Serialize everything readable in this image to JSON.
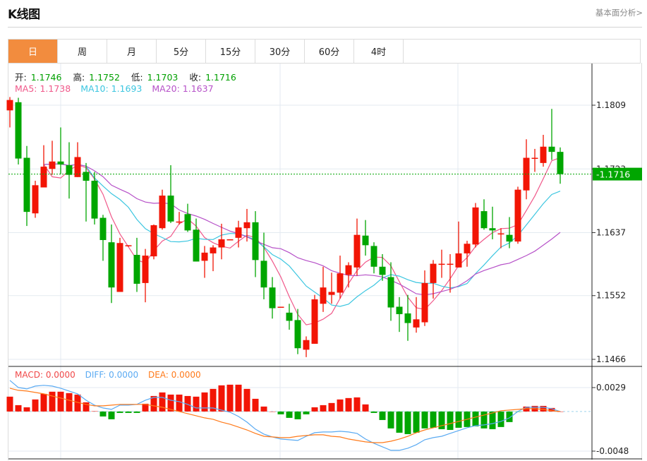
{
  "header": {
    "title": "K线图",
    "fundamental_link": "基本面分析>"
  },
  "tabs": [
    {
      "label": "日",
      "active": true
    },
    {
      "label": "周"
    },
    {
      "label": "月"
    },
    {
      "label": "5分"
    },
    {
      "label": "15分"
    },
    {
      "label": "30分"
    },
    {
      "label": "60分"
    },
    {
      "label": "4时"
    }
  ],
  "ohlc_legend": {
    "open_label": "开:",
    "open": "1.1746",
    "high_label": "高:",
    "high": "1.1752",
    "low_label": "低:",
    "low": "1.1703",
    "close_label": "收:",
    "close": "1.1716"
  },
  "ma_legend": {
    "ma5": "MA5: 1.1738",
    "ma10": "MA10: 1.1693",
    "ma20": "MA20: 1.1637"
  },
  "macd_legend": {
    "macd": "MACD: 0.0000",
    "diff": "DIFF: 0.0000",
    "dea": "DEA: 0.0000"
  },
  "colors": {
    "up": "#f21505",
    "down": "#00a600",
    "ma5": "#f0588a",
    "ma10": "#3cc6e0",
    "ma20": "#b651c8",
    "diff": "#5aaaf2",
    "dea": "#ff7a1a",
    "accent": "#f28c3e",
    "current_price": "#00a600"
  },
  "chart_data": [
    {
      "type": "candlestick",
      "price_ticks": [
        "1.1809",
        "1.1723",
        "1.1637",
        "1.1552",
        "1.1466"
      ],
      "ylim": [
        1.1466,
        1.1809
      ],
      "current_price": "1.1716",
      "grid": true,
      "ma_periods": [
        5,
        10,
        20
      ],
      "ohlc": [
        [
          1.1802,
          1.182,
          1.1779,
          1.1816
        ],
        [
          1.1813,
          1.1819,
          1.1729,
          1.1737
        ],
        [
          1.1738,
          1.1754,
          1.1646,
          1.1665
        ],
        [
          1.1663,
          1.1707,
          1.1657,
          1.1701
        ],
        [
          1.1698,
          1.1755,
          1.1698,
          1.1726
        ],
        [
          1.1723,
          1.1761,
          1.1715,
          1.1733
        ],
        [
          1.1733,
          1.1779,
          1.1716,
          1.1729
        ],
        [
          1.1728,
          1.1759,
          1.1683,
          1.1715
        ],
        [
          1.1712,
          1.1759,
          1.1712,
          1.1739
        ],
        [
          1.1719,
          1.1731,
          1.1652,
          1.1707
        ],
        [
          1.1707,
          1.1719,
          1.1648,
          1.1656
        ],
        [
          1.1657,
          1.1661,
          1.1599,
          1.1627
        ],
        [
          1.1624,
          1.1648,
          1.1542,
          1.1563
        ],
        [
          1.1557,
          1.163,
          1.1557,
          1.1623
        ],
        [
          1.1619,
          1.162,
          1.1618,
          1.162
        ],
        [
          1.1607,
          1.163,
          1.1557,
          1.1568
        ],
        [
          1.1569,
          1.1615,
          1.1543,
          1.1606
        ],
        [
          1.1605,
          1.1648,
          1.1601,
          1.1647
        ],
        [
          1.1643,
          1.1695,
          1.1641,
          1.1687
        ],
        [
          1.1687,
          1.1728,
          1.165,
          1.1652
        ],
        [
          1.1651,
          1.1665,
          1.1648,
          1.1652
        ],
        [
          1.1662,
          1.1676,
          1.1638,
          1.164
        ],
        [
          1.1641,
          1.1656,
          1.1598,
          1.1598
        ],
        [
          1.1599,
          1.1619,
          1.1576,
          1.161
        ],
        [
          1.1609,
          1.162,
          1.1585,
          1.1617
        ],
        [
          1.1617,
          1.1649,
          1.1601,
          1.1628
        ],
        [
          1.1627,
          1.1628,
          1.1627,
          1.1628
        ],
        [
          1.163,
          1.1653,
          1.1617,
          1.1644
        ],
        [
          1.1643,
          1.1669,
          1.1625,
          1.1651
        ],
        [
          1.1651,
          1.1666,
          1.1577,
          1.16
        ],
        [
          1.1599,
          1.1637,
          1.1547,
          1.1563
        ],
        [
          1.1563,
          1.1577,
          1.1521,
          1.1535
        ],
        [
          1.1536,
          1.1537,
          1.1536,
          1.1537
        ],
        [
          1.1529,
          1.1541,
          1.1506,
          1.1518
        ],
        [
          1.1519,
          1.1534,
          1.1473,
          1.1481
        ],
        [
          1.1479,
          1.1497,
          1.1469,
          1.1492
        ],
        [
          1.1487,
          1.1553,
          1.1487,
          1.1547
        ],
        [
          1.1541,
          1.1591,
          1.153,
          1.1563
        ],
        [
          1.1553,
          1.1583,
          1.1541,
          1.1557
        ],
        [
          1.1556,
          1.1606,
          1.1548,
          1.1582
        ],
        [
          1.158,
          1.1597,
          1.1563,
          1.1593
        ],
        [
          1.159,
          1.1656,
          1.1579,
          1.1634
        ],
        [
          1.1633,
          1.1654,
          1.1606,
          1.162
        ],
        [
          1.1619,
          1.1624,
          1.1582,
          1.1591
        ],
        [
          1.1591,
          1.1608,
          1.1572,
          1.158
        ],
        [
          1.1577,
          1.1597,
          1.1518,
          1.1536
        ],
        [
          1.1537,
          1.155,
          1.1503,
          1.1527
        ],
        [
          1.1528,
          1.1553,
          1.1491,
          1.1515
        ],
        [
          1.1509,
          1.155,
          1.1502,
          1.152
        ],
        [
          1.1516,
          1.1586,
          1.1511,
          1.1569
        ],
        [
          1.1569,
          1.16,
          1.1548,
          1.1595
        ],
        [
          1.1594,
          1.1614,
          1.1576,
          1.1595
        ],
        [
          1.1594,
          1.1608,
          1.1556,
          1.1595
        ],
        [
          1.159,
          1.1652,
          1.159,
          1.1609
        ],
        [
          1.1609,
          1.1626,
          1.1591,
          1.1622
        ],
        [
          1.1621,
          1.1677,
          1.1617,
          1.1671
        ],
        [
          1.1666,
          1.1682,
          1.1641,
          1.1643
        ],
        [
          1.1643,
          1.1672,
          1.1628,
          1.164
        ],
        [
          1.1635,
          1.1643,
          1.1616,
          1.1636
        ],
        [
          1.1634,
          1.1658,
          1.1616,
          1.1625
        ],
        [
          1.1625,
          1.1699,
          1.1622,
          1.1695
        ],
        [
          1.1694,
          1.1763,
          1.1682,
          1.1738
        ],
        [
          1.1737,
          1.175,
          1.1719,
          1.1738
        ],
        [
          1.1731,
          1.1769,
          1.1726,
          1.1753
        ],
        [
          1.1753,
          1.1804,
          1.1735,
          1.1746
        ],
        [
          1.1746,
          1.1752,
          1.1703,
          1.1716
        ]
      ]
    },
    {
      "type": "macd",
      "ticks": [
        "0.0029",
        "-0.0048"
      ],
      "ylim": [
        -0.0048,
        0.0029
      ],
      "histogram": [
        0.0018,
        0.00077,
        0.00051,
        0.00146,
        0.00214,
        0.0024,
        0.0024,
        0.00223,
        0.00205,
        0.00111,
        4e-05,
        -0.0006,
        -0.00094,
        -0.00017,
        -0.00017,
        -0.00017,
        0.00094,
        0.00188,
        0.00231,
        0.00205,
        0.00205,
        0.00188,
        0.0018,
        0.00231,
        0.00274,
        0.00317,
        0.00325,
        0.00325,
        0.00274,
        0.00154,
        0.0006,
        0,
        -0.00034,
        -0.00077,
        -0.00094,
        -0.00034,
        0.00051,
        0.00077,
        0.00103,
        0.00146,
        0.00163,
        0.00171,
        0.00086,
        -0.00017,
        -0.00103,
        -0.00205,
        -0.00257,
        -0.00274,
        -0.00257,
        -0.00205,
        -0.00197,
        -0.00214,
        -0.00223,
        -0.00197,
        -0.00188,
        -0.0018,
        -0.00205,
        -0.00214,
        -0.00188,
        -0.00128,
        -4e-05,
        0.0006,
        0.00068,
        0.00068,
        0.00043,
        0
      ],
      "diff": [
        0.00377,
        0.00291,
        0.00274,
        0.00308,
        0.00317,
        0.00308,
        0.00282,
        0.00248,
        0.00214,
        0.00137,
        0.00077,
        0.00043,
        0.00026,
        0.00077,
        0.00077,
        0.00086,
        0.00137,
        0.00171,
        0.00171,
        0.00137,
        0.0012,
        0.00086,
        0.00043,
        0.00043,
        0.00043,
        0.00017,
        -9e-05,
        -0.0006,
        -0.00128,
        -0.00214,
        -0.00274,
        -0.00308,
        -0.00334,
        -0.00342,
        -0.00351,
        -0.003,
        -0.00257,
        -0.00248,
        -0.00248,
        -0.0024,
        -0.00248,
        -0.00265,
        -0.00334,
        -0.00385,
        -0.00428,
        -0.00471,
        -0.00471,
        -0.00445,
        -0.00402,
        -0.00342,
        -0.00317,
        -0.003,
        -0.00265,
        -0.00231,
        -0.00197,
        -0.00171,
        -0.00163,
        -0.00146,
        -0.0012,
        -0.00077,
        0,
        0.00051,
        0.00051,
        0.00051,
        0.00034,
        0
      ],
      "dea": [
        0.00282,
        0.00257,
        0.00248,
        0.00231,
        0.00214,
        0.00188,
        0.00163,
        0.00137,
        0.00111,
        0.00086,
        0.00068,
        0.00068,
        0.00077,
        0.00086,
        0.00086,
        0.00086,
        0.00086,
        0.00068,
        0.00051,
        0.00026,
        0,
        -0.00026,
        -0.00051,
        -0.00077,
        -0.00094,
        -0.00128,
        -0.00154,
        -0.00188,
        -0.00223,
        -0.00265,
        -0.003,
        -0.00308,
        -0.00317,
        -0.00317,
        -0.003,
        -0.00291,
        -0.00282,
        -0.00282,
        -0.003,
        -0.00308,
        -0.00334,
        -0.00351,
        -0.00368,
        -0.00377,
        -0.00377,
        -0.0036,
        -0.00334,
        -0.003,
        -0.00257,
        -0.00223,
        -0.00197,
        -0.00171,
        -0.00146,
        -0.0012,
        -0.00094,
        -0.00068,
        -0.00043,
        -0.00017,
        9e-05,
        0.00017,
        0.00026,
        0.00034,
        0.00034,
        0.00026,
        9e-05,
        0
      ]
    }
  ]
}
